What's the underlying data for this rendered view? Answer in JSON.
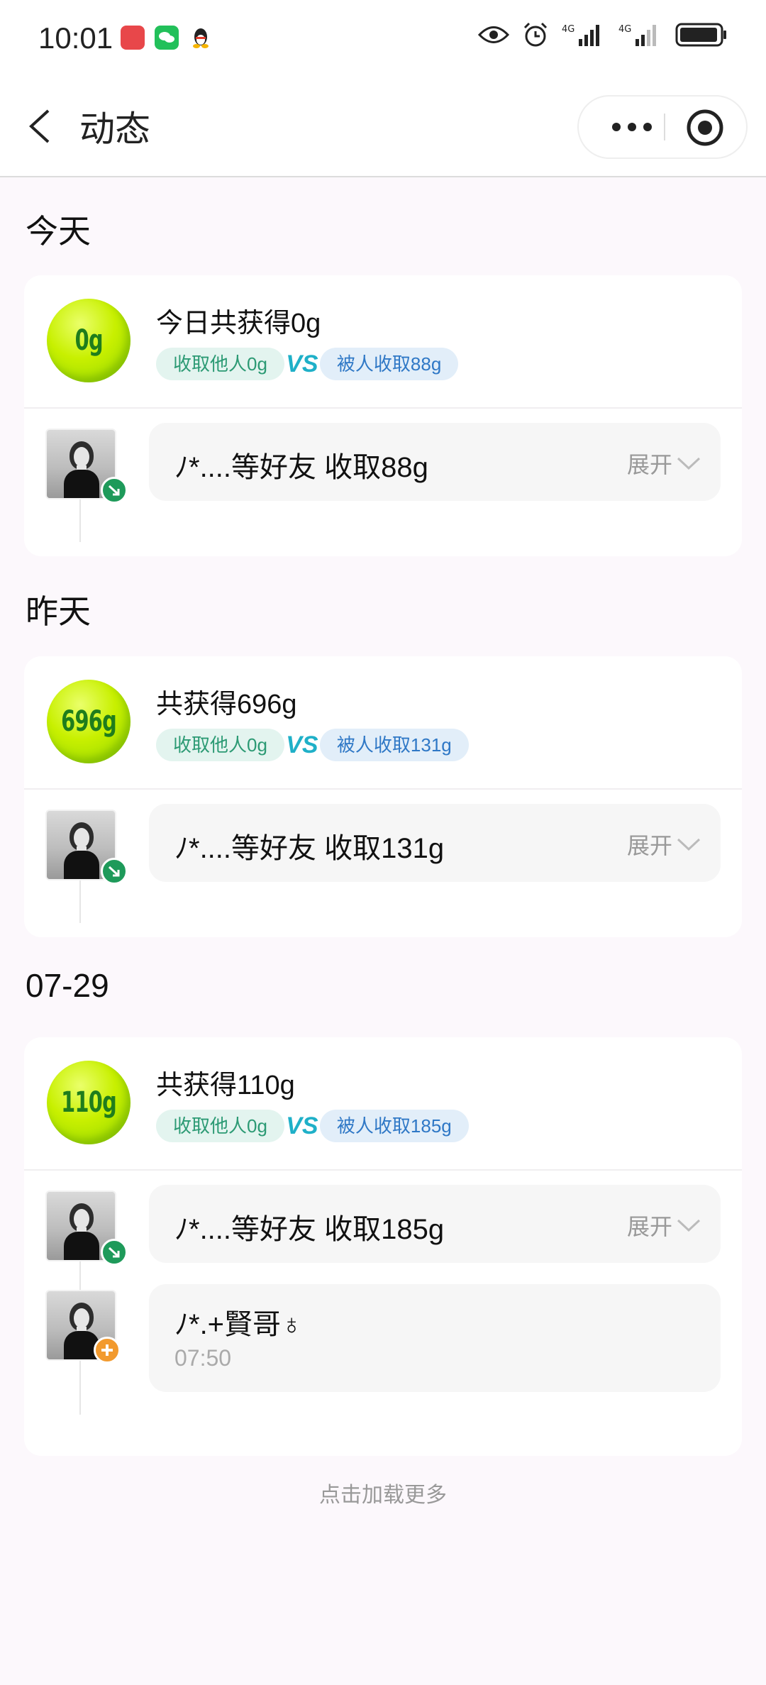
{
  "status_bar": {
    "time": "10:01",
    "icons": [
      "huawei-appgallery-icon",
      "wechat-icon",
      "qq-icon",
      "eye-icon",
      "alarm-icon",
      "signal-4g-icon",
      "signal-4g-icon",
      "battery-icon"
    ]
  },
  "nav": {
    "title": "动态",
    "back_icon": "chevron-left-icon",
    "more_icon": "more-icon",
    "close_icon": "target-icon"
  },
  "sections": [
    {
      "title": "今天",
      "ball_value": "0g",
      "summary": "今日共获得0g",
      "tag_collect_others": "收取他人0g",
      "tag_collected_by": "被人收取88g",
      "friends_text": "ﾉ*....等好友 收取88g",
      "expand_label": "展开"
    },
    {
      "title": "昨天",
      "ball_value": "696g",
      "summary": "共获得696g",
      "tag_collect_others": "收取他人0g",
      "tag_collected_by": "被人收取131g",
      "friends_text": "ﾉ*....等好友 收取131g",
      "expand_label": "展开"
    },
    {
      "title": "07-29",
      "ball_value": "110g",
      "summary": "共获得110g",
      "tag_collect_others": "收取他人0g",
      "tag_collected_by": "被人收取185g",
      "friends_text": "ﾉ*....等好友 收取185g",
      "expand_label": "展开",
      "extra": {
        "name": "ﾉ*.+賢哥♁",
        "time": "07:50"
      }
    }
  ],
  "load_more": "点击加载更多",
  "colors": {
    "tag_green_bg": "#e3f4ef",
    "tag_green_text": "#2c9a74",
    "tag_blue_bg": "#e2eef9",
    "tag_blue_text": "#2f78c6",
    "ball": "#c8f000"
  }
}
